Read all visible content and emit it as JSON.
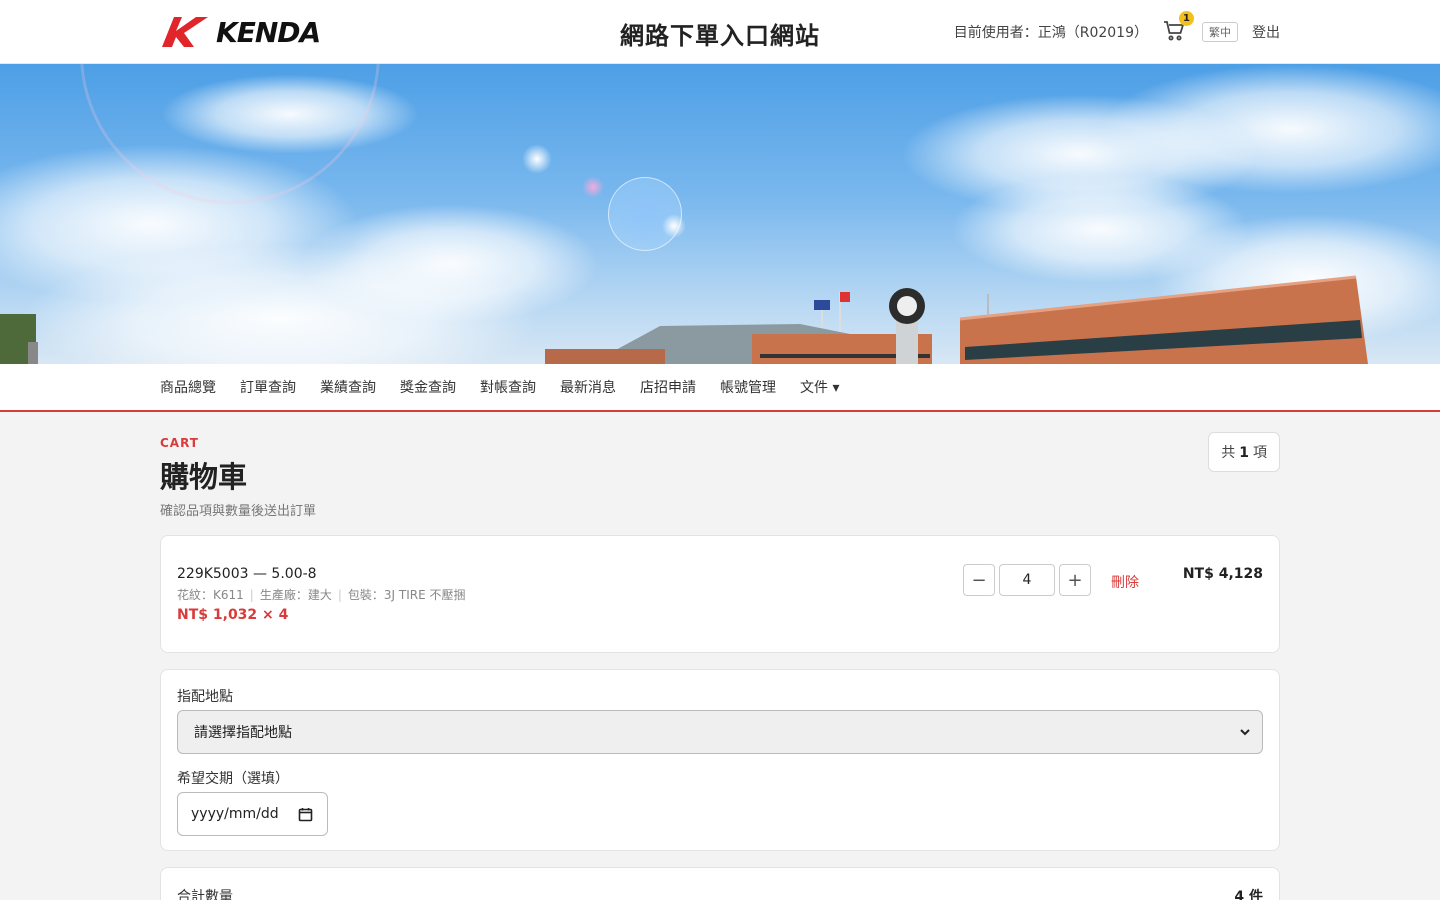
{
  "header": {
    "logo_text": "KENDA",
    "title": "網路下單入口網站",
    "user_text": "目前使用者：正鴻（R02019）",
    "cart_count": "1",
    "lang_label": "繁中",
    "logout_label": "登出",
    "brand_color": "#d93a3a"
  },
  "nav": {
    "items": [
      "商品總覽",
      "訂單查詢",
      "業績查詢",
      "獎金查詢",
      "對帳查詢",
      "最新消息",
      "店招申請",
      "帳號管理",
      "文件 ▾"
    ]
  },
  "cart": {
    "eyebrow": "CART",
    "title": "購物車",
    "subtitle": "確認品項與數量後送出訂單",
    "count_prefix": "共",
    "count_value": "1",
    "count_suffix": "項",
    "item": {
      "title": "229K5003 — 5.00-8",
      "pattern": "花紋：K611",
      "factory": "生產廠：建大",
      "packaging": "包裝：3J TIRE 不壓捆",
      "unit_price": "NT$ 1,032 × 4",
      "quantity": "4",
      "minus_label": "−",
      "plus_label": "+",
      "delete_label": "刪除",
      "line_total": "NT$ 4,128"
    },
    "form": {
      "location_label": "指配地點",
      "location_value": "請選擇指配地點",
      "date_label": "希望交期（選填）",
      "date_placeholder": "yyyy/mm/dd"
    },
    "summary": {
      "qty_label": "合計數量",
      "qty_value": "4 件"
    }
  }
}
